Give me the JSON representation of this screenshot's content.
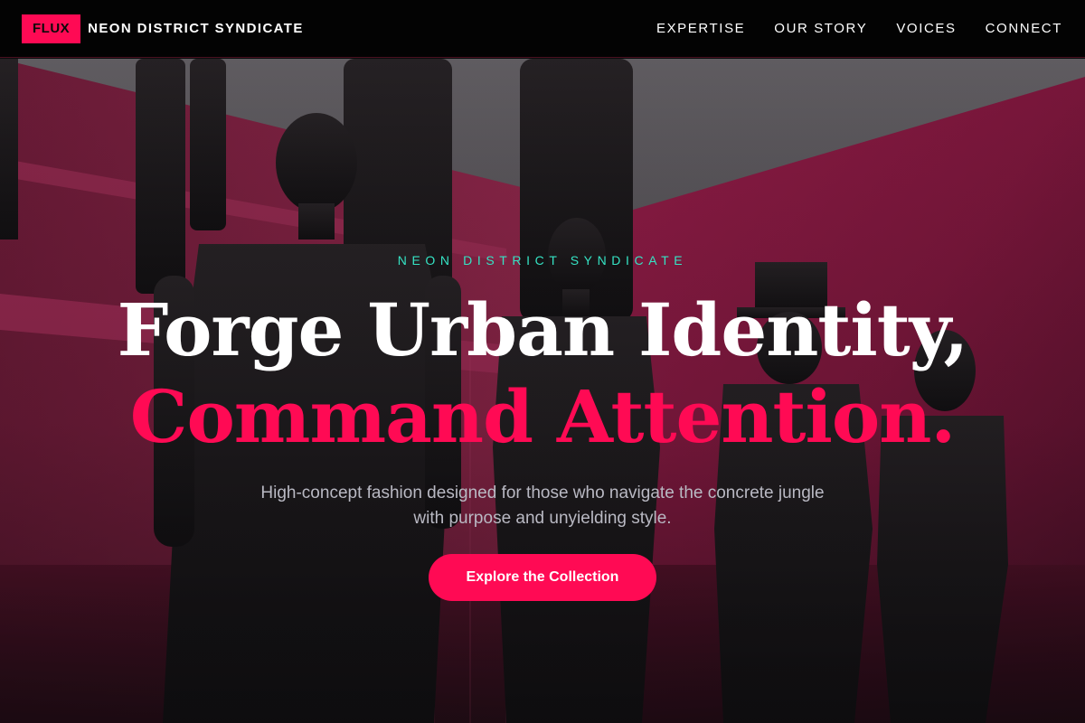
{
  "nav": {
    "logo": "FLUX",
    "brand": "NEON DISTRICT SYNDICATE",
    "links": [
      "EXPERTISE",
      "OUR STORY",
      "VOICES",
      "CONNECT"
    ]
  },
  "hero": {
    "eyebrow": "NEON DISTRICT SYNDICATE",
    "headline_line1": "Forge Urban Identity,",
    "headline_line2": "Command Attention.",
    "subtitle": "High-concept fashion designed for those who navigate the concrete jungle with purpose and unyielding style.",
    "cta": "Explore the Collection",
    "background_description_icon": "mannequin-gallery-image"
  },
  "colors": {
    "accent": "#ff0a54",
    "teal": "#35e3c4",
    "nav_bg": "#030303",
    "wall_magenta": "#8a1a44"
  }
}
